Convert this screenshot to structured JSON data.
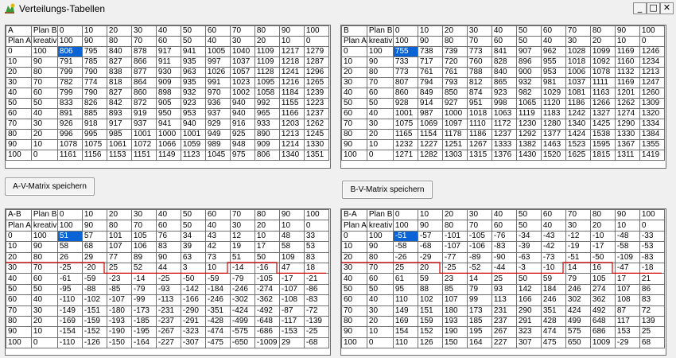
{
  "window": {
    "title": "Verteilungs-Tabellen",
    "minimize": "_",
    "maximize": "□",
    "close": "✕"
  },
  "buttons": {
    "av_save": "A-V-Matrix speichern",
    "bv_save": "B-V-Matrix speichern"
  },
  "colors": {
    "selection": "#0a64d6",
    "marker_line": "#d00000"
  },
  "grids": [
    {
      "name": "grid-av",
      "header1": [
        "A",
        "Plan B",
        "0",
        "10",
        "20",
        "30",
        "40",
        "50",
        "60",
        "70",
        "80",
        "90",
        "100"
      ],
      "header2": [
        "Plan A",
        "kreativ",
        "100",
        "90",
        "80",
        "70",
        "60",
        "50",
        "40",
        "30",
        "20",
        "10",
        "0"
      ],
      "rows": [
        [
          "0",
          "100",
          "806",
          "795",
          "840",
          "878",
          "917",
          "941",
          "1005",
          "1040",
          "1109",
          "1217",
          "1279"
        ],
        [
          "10",
          "90",
          "791",
          "785",
          "827",
          "866",
          "911",
          "935",
          "997",
          "1037",
          "1109",
          "1218",
          "1287"
        ],
        [
          "20",
          "80",
          "799",
          "790",
          "838",
          "877",
          "930",
          "963",
          "1026",
          "1057",
          "1128",
          "1241",
          "1296"
        ],
        [
          "30",
          "70",
          "782",
          "774",
          "818",
          "864",
          "909",
          "935",
          "991",
          "1023",
          "1095",
          "1216",
          "1265"
        ],
        [
          "40",
          "60",
          "799",
          "790",
          "827",
          "860",
          "898",
          "932",
          "970",
          "1002",
          "1058",
          "1184",
          "1239"
        ],
        [
          "50",
          "50",
          "833",
          "826",
          "842",
          "872",
          "905",
          "923",
          "936",
          "940",
          "992",
          "1155",
          "1223"
        ],
        [
          "60",
          "40",
          "891",
          "885",
          "893",
          "919",
          "950",
          "953",
          "937",
          "940",
          "965",
          "1166",
          "1237"
        ],
        [
          "70",
          "30",
          "926",
          "918",
          "917",
          "937",
          "941",
          "940",
          "929",
          "916",
          "933",
          "1203",
          "1262"
        ],
        [
          "80",
          "20",
          "996",
          "995",
          "985",
          "1001",
          "1000",
          "1001",
          "949",
          "925",
          "890",
          "1213",
          "1245"
        ],
        [
          "90",
          "10",
          "1078",
          "1075",
          "1061",
          "1072",
          "1066",
          "1059",
          "989",
          "948",
          "909",
          "1214",
          "1330"
        ],
        [
          "100",
          "0",
          "1161",
          "1156",
          "1153",
          "1151",
          "1149",
          "1123",
          "1045",
          "975",
          "806",
          "1340",
          "1351"
        ]
      ]
    },
    {
      "name": "grid-bv",
      "header1": [
        "B",
        "Plan B",
        "0",
        "10",
        "20",
        "30",
        "40",
        "50",
        "60",
        "70",
        "80",
        "90",
        "100"
      ],
      "header2": [
        "Plan A",
        "kreativ",
        "100",
        "90",
        "80",
        "70",
        "60",
        "50",
        "40",
        "30",
        "20",
        "10",
        "0"
      ],
      "rows": [
        [
          "0",
          "100",
          "755",
          "738",
          "739",
          "773",
          "841",
          "907",
          "962",
          "1028",
          "1099",
          "1169",
          "1246"
        ],
        [
          "10",
          "90",
          "733",
          "717",
          "720",
          "760",
          "828",
          "896",
          "955",
          "1018",
          "1092",
          "1160",
          "1234"
        ],
        [
          "20",
          "80",
          "773",
          "761",
          "761",
          "788",
          "840",
          "900",
          "953",
          "1006",
          "1078",
          "1132",
          "1213"
        ],
        [
          "30",
          "70",
          "807",
          "794",
          "793",
          "812",
          "865",
          "932",
          "981",
          "1037",
          "1111",
          "1169",
          "1247"
        ],
        [
          "40",
          "60",
          "860",
          "849",
          "850",
          "874",
          "923",
          "982",
          "1029",
          "1081",
          "1163",
          "1201",
          "1260"
        ],
        [
          "50",
          "50",
          "928",
          "914",
          "927",
          "951",
          "998",
          "1065",
          "1120",
          "1186",
          "1266",
          "1262",
          "1309"
        ],
        [
          "60",
          "40",
          "1001",
          "987",
          "1000",
          "1018",
          "1063",
          "1119",
          "1183",
          "1242",
          "1327",
          "1274",
          "1320"
        ],
        [
          "70",
          "30",
          "1075",
          "1069",
          "1097",
          "1110",
          "1172",
          "1230",
          "1280",
          "1340",
          "1425",
          "1290",
          "1334"
        ],
        [
          "80",
          "20",
          "1165",
          "1154",
          "1178",
          "1186",
          "1237",
          "1292",
          "1377",
          "1424",
          "1538",
          "1330",
          "1384"
        ],
        [
          "90",
          "10",
          "1232",
          "1227",
          "1251",
          "1267",
          "1333",
          "1382",
          "1463",
          "1523",
          "1595",
          "1367",
          "1355"
        ],
        [
          "100",
          "0",
          "1271",
          "1282",
          "1303",
          "1315",
          "1376",
          "1430",
          "1520",
          "1625",
          "1815",
          "1311",
          "1419"
        ]
      ]
    },
    {
      "name": "grid-ab",
      "header1": [
        "A-B",
        "Plan B",
        "0",
        "10",
        "20",
        "30",
        "40",
        "50",
        "60",
        "70",
        "80",
        "90",
        "100"
      ],
      "header2": [
        "Plan A",
        "kreativ",
        "100",
        "90",
        "80",
        "70",
        "60",
        "50",
        "40",
        "30",
        "20",
        "10",
        "0"
      ],
      "rows": [
        [
          "0",
          "100",
          "51",
          "57",
          "101",
          "105",
          "76",
          "34",
          "43",
          "12",
          "10",
          "48",
          "33"
        ],
        [
          "10",
          "90",
          "58",
          "68",
          "107",
          "106",
          "83",
          "39",
          "42",
          "19",
          "17",
          "58",
          "53"
        ],
        [
          "20",
          "80",
          "26",
          "29",
          "77",
          "89",
          "90",
          "63",
          "73",
          "51",
          "50",
          "109",
          "83"
        ],
        [
          "30",
          "70",
          "-25",
          "-20",
          "25",
          "52",
          "44",
          "3",
          "10",
          "-14",
          "-16",
          "47",
          "18"
        ],
        [
          "40",
          "60",
          "-61",
          "-59",
          "-23",
          "-14",
          "-25",
          "-50",
          "-59",
          "-79",
          "-105",
          "-17",
          "-21"
        ],
        [
          "50",
          "50",
          "-95",
          "-88",
          "-85",
          "-79",
          "-93",
          "-142",
          "-184",
          "-246",
          "-274",
          "-107",
          "-86"
        ],
        [
          "60",
          "40",
          "-110",
          "-102",
          "-107",
          "-99",
          "-113",
          "-166",
          "-246",
          "-302",
          "-362",
          "-108",
          "-83"
        ],
        [
          "70",
          "30",
          "-149",
          "-151",
          "-180",
          "-173",
          "-231",
          "-290",
          "-351",
          "-424",
          "-492",
          "-87",
          "-72"
        ],
        [
          "80",
          "20",
          "-169",
          "-159",
          "-193",
          "-185",
          "-237",
          "-291",
          "-428",
          "-499",
          "-648",
          "-117",
          "-139"
        ],
        [
          "90",
          "10",
          "-154",
          "-152",
          "-190",
          "-195",
          "-267",
          "-323",
          "-474",
          "-575",
          "-686",
          "-153",
          "-25"
        ],
        [
          "100",
          "0",
          "-110",
          "-126",
          "-150",
          "-164",
          "-227",
          "-307",
          "-475",
          "-650",
          "-1009",
          "29",
          "-68"
        ]
      ]
    },
    {
      "name": "grid-ba",
      "header1": [
        "B-A",
        "Plan B",
        "0",
        "10",
        "20",
        "30",
        "40",
        "50",
        "60",
        "70",
        "80",
        "90",
        "100"
      ],
      "header2": [
        "Plan A",
        "kreativ",
        "100",
        "90",
        "80",
        "70",
        "60",
        "50",
        "40",
        "30",
        "20",
        "10",
        "0"
      ],
      "rows": [
        [
          "0",
          "100",
          "-51",
          "-57",
          "-101",
          "-105",
          "-76",
          "-34",
          "-43",
          "-12",
          "-10",
          "-48",
          "-33"
        ],
        [
          "10",
          "90",
          "-58",
          "-68",
          "-107",
          "-106",
          "-83",
          "-39",
          "-42",
          "-19",
          "-17",
          "-58",
          "-53"
        ],
        [
          "20",
          "80",
          "-26",
          "-29",
          "-77",
          "-89",
          "-90",
          "-63",
          "-73",
          "-51",
          "-50",
          "-109",
          "-83"
        ],
        [
          "30",
          "70",
          "25",
          "20",
          "-25",
          "-52",
          "-44",
          "-3",
          "-10",
          "14",
          "16",
          "-47",
          "-18"
        ],
        [
          "40",
          "60",
          "61",
          "59",
          "23",
          "14",
          "25",
          "50",
          "59",
          "79",
          "105",
          "17",
          "21"
        ],
        [
          "50",
          "50",
          "95",
          "88",
          "85",
          "79",
          "93",
          "142",
          "184",
          "246",
          "274",
          "107",
          "86"
        ],
        [
          "60",
          "40",
          "110",
          "102",
          "107",
          "99",
          "113",
          "166",
          "246",
          "302",
          "362",
          "108",
          "83"
        ],
        [
          "70",
          "30",
          "149",
          "151",
          "180",
          "173",
          "231",
          "290",
          "351",
          "424",
          "492",
          "87",
          "72"
        ],
        [
          "80",
          "20",
          "169",
          "159",
          "193",
          "185",
          "237",
          "291",
          "428",
          "499",
          "648",
          "117",
          "139"
        ],
        [
          "90",
          "10",
          "154",
          "152",
          "190",
          "195",
          "267",
          "323",
          "474",
          "575",
          "686",
          "153",
          "25"
        ],
        [
          "100",
          "0",
          "110",
          "126",
          "150",
          "164",
          "227",
          "307",
          "475",
          "650",
          "1009",
          "-29",
          "68"
        ]
      ]
    }
  ]
}
